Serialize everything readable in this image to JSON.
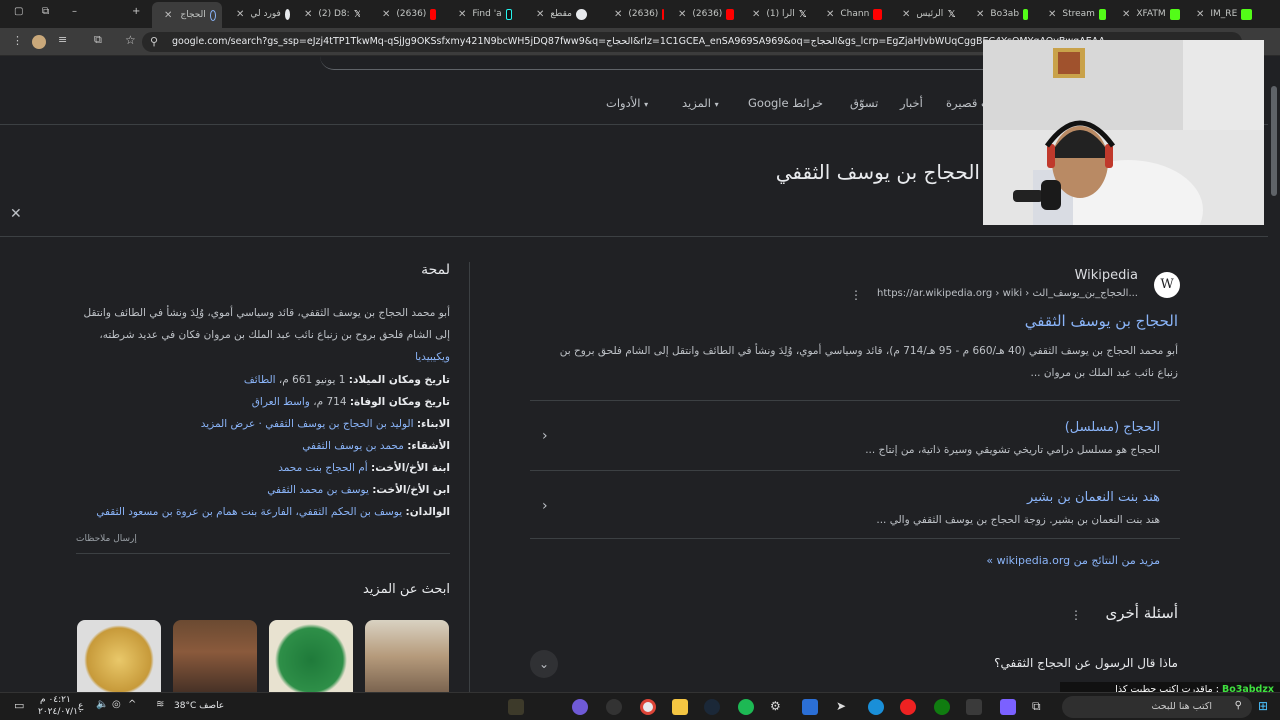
{
  "tabs": [
    {
      "label": "الحجاج",
      "active": true
    },
    {
      "label": "فورد لي"
    },
    {
      "label": "(2) D8:"
    },
    {
      "label": "(2636)"
    },
    {
      "label": "Find 'a"
    },
    {
      "label": "مقطع"
    },
    {
      "label": "(2636)"
    },
    {
      "label": "(2636)"
    },
    {
      "label": "(1) الرا"
    },
    {
      "label": "Chann"
    },
    {
      "label": "الرئيس"
    },
    {
      "label": "Bo3ab"
    },
    {
      "label": "Stream"
    },
    {
      "label": "XFATM"
    },
    {
      "label": "IM_RE"
    }
  ],
  "toolbar": {
    "url": "google.com/search?gs_ssp=eJzj4tTP1TkwMq-qSjJg9OKSsfxmy421N9bcWH5jDQ87fww9&q=الحجاج&rlz=1C1GCEA_enSA969SA969&oq=الحجاج&gs_lcrp=EgZjaHJvbWUqCggBEC4YsQMYgAQyBwgAEAA"
  },
  "nav": {
    "tools": "الأدوات",
    "more": "المزيد",
    "maps": "خرائط Google",
    "shopping": "تسوّق",
    "news": "أخبار",
    "short_videos": "فيديوهات قصيرة"
  },
  "page_title": "الحجاج بن يوسف الثقفي",
  "knowledge_panel": {
    "title": "لمحة",
    "description": "أبو محمد الحجاج بن يوسف الثقفي، قائد وسياسي أموي، وُلِدَ ونشأ في الطائف وانتقل إلى الشام فلحق بروح بن زنباع نائب عبد الملك بن مروان فكان في عديد شرطته،",
    "description_link": "ويكيبيديا",
    "facts": [
      {
        "label": "تاريخ ومكان الميلاد:",
        "value": "1 يونيو 661 م،",
        "link": "الطائف"
      },
      {
        "label": "تاريخ ومكان الوفاة:",
        "value": "714 م،",
        "link": "واسط العراق"
      },
      {
        "label": "الابناء:",
        "value": "",
        "link": "الوليد بن الحجاج بن يوسف الثقفي · عرض المزيد"
      },
      {
        "label": "الأشقاء:",
        "value": "",
        "link": "محمد بن يوسف الثقفي"
      },
      {
        "label": "ابنة الأخ/الأخت:",
        "value": "",
        "link": "أم الحجاج بنت محمد"
      },
      {
        "label": "ابن الأخ/الأخت:",
        "value": "",
        "link": "يوسف بن محمد الثقفي"
      },
      {
        "label": "الوالدان:",
        "value": "",
        "link": "يوسف بن الحكم الثقفي، الفارعة بنت همام بن عروة بن مسعود الثقفي"
      }
    ],
    "feedback": "إرسال ملاحظات",
    "more_title": "ابحث عن المزيد"
  },
  "result": {
    "site_name": "Wikipedia",
    "logo_letter": "W",
    "site_url": "https://ar.wikipedia.org › wiki › الحجاج_بن_يوسف_الث...",
    "title": "الحجاج بن يوسف الثقفي",
    "snippet": "أبو محمد الحجاج بن يوسف الثقفي (40 هـ/660 م - 95 هـ/714 م)، قائد وسياسي أموي، وُلِدَ ونشأ في الطائف وانتقل إلى الشام فلحق بروح بن زنباع نائب عبد الملك بن مروان ...",
    "subresults": [
      {
        "title": "الحجاج (مسلسل)",
        "snippet": "الحجاج هو مسلسل درامي تاريخي تشويقي وسيرة ذاتية، من إنتاج ..."
      },
      {
        "title": "هند بنت النعمان بن بشير",
        "snippet": "هند بنت النعمان بن بشير. زوجة الحجاج بن يوسف الثقفي والي ..."
      }
    ],
    "more_results": "مزيد من النتائج من wikipedia.org »"
  },
  "paa": {
    "title": "أسئلة أخرى",
    "q1": "ماذا قال الرسول عن الحجاج الثقفي؟"
  },
  "taskbar": {
    "weather": "38°C  عاصف",
    "search_placeholder": "اكتب هنا للبحث",
    "time": "٠٤:٢١ م",
    "date": "٢٠٢٤/٠٧/١٠",
    "lang": "ع"
  },
  "stream_overlay": {
    "name": "Bo3abdzx",
    "message": ": ماقدرت اكتب حطيت كذا"
  },
  "colors": {
    "page_bg": "#202124",
    "link": "#8ab4f8",
    "text": "#e8eaed",
    "muted": "#bdc1c6"
  }
}
